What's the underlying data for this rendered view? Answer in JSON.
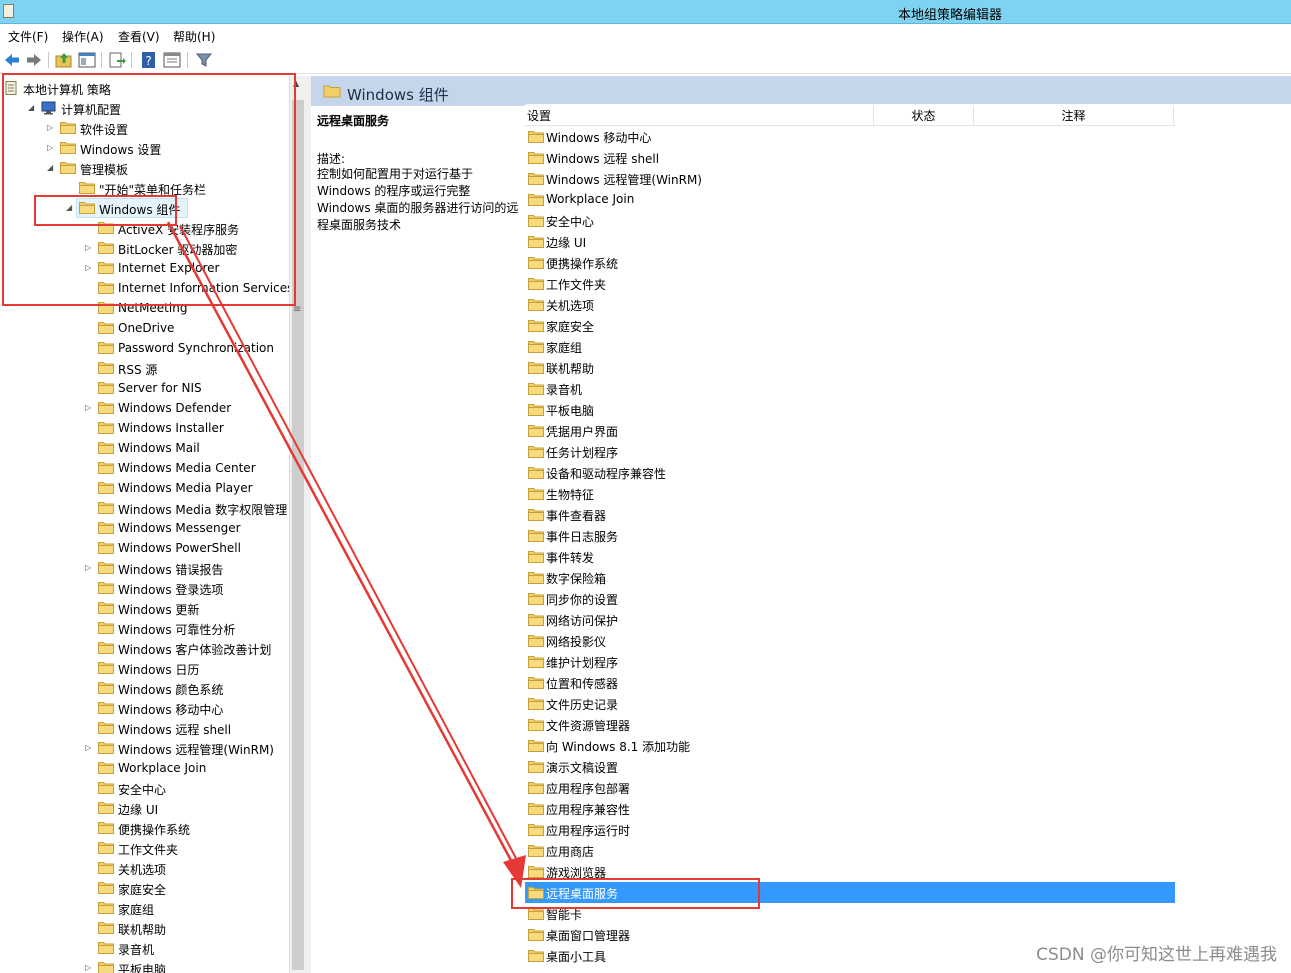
{
  "window": {
    "title": "本地组策略编辑器"
  },
  "menu": [
    "文件(F)",
    "操作(A)",
    "查看(V)",
    "帮助(H)"
  ],
  "toolbar_icons": [
    "back-icon",
    "forward-icon",
    "up-folder-icon",
    "show-hide-tree-icon",
    "export-list-icon",
    "help-icon",
    "properties-icon",
    "filter-icon"
  ],
  "tree": {
    "items": [
      {
        "label": "本地计算机 策略",
        "level": 0,
        "expander": "",
        "icon": "policy"
      },
      {
        "label": "计算机配置",
        "level": 1,
        "expander": "open",
        "icon": "computer"
      },
      {
        "label": "软件设置",
        "level": 2,
        "expander": "closed",
        "icon": "folder"
      },
      {
        "label": "Windows 设置",
        "level": 2,
        "expander": "closed",
        "icon": "folder"
      },
      {
        "label": "管理模板",
        "level": 2,
        "expander": "open",
        "icon": "folder"
      },
      {
        "label": "\"开始\"菜单和任务栏",
        "level": 3,
        "expander": "",
        "icon": "folder"
      },
      {
        "label": "Windows 组件",
        "level": 3,
        "expander": "open",
        "icon": "folder",
        "selected": true
      },
      {
        "label": "ActiveX 安装程序服务",
        "level": 4,
        "expander": "",
        "icon": "folder"
      },
      {
        "label": "BitLocker 驱动器加密",
        "level": 4,
        "expander": "closed",
        "icon": "folder"
      },
      {
        "label": "Internet Explorer",
        "level": 4,
        "expander": "closed",
        "icon": "folder"
      },
      {
        "label": "Internet Information Services",
        "level": 4,
        "expander": "",
        "icon": "folder"
      },
      {
        "label": "NetMeeting",
        "level": 4,
        "expander": "",
        "icon": "folder"
      },
      {
        "label": "OneDrive",
        "level": 4,
        "expander": "",
        "icon": "folder"
      },
      {
        "label": "Password Synchronization",
        "level": 4,
        "expander": "",
        "icon": "folder"
      },
      {
        "label": "RSS 源",
        "level": 4,
        "expander": "",
        "icon": "folder"
      },
      {
        "label": "Server for NIS",
        "level": 4,
        "expander": "",
        "icon": "folder"
      },
      {
        "label": "Windows Defender",
        "level": 4,
        "expander": "closed",
        "icon": "folder"
      },
      {
        "label": "Windows Installer",
        "level": 4,
        "expander": "",
        "icon": "folder"
      },
      {
        "label": "Windows Mail",
        "level": 4,
        "expander": "",
        "icon": "folder"
      },
      {
        "label": "Windows Media Center",
        "level": 4,
        "expander": "",
        "icon": "folder"
      },
      {
        "label": "Windows Media Player",
        "level": 4,
        "expander": "",
        "icon": "folder"
      },
      {
        "label": "Windows Media 数字权限管理",
        "level": 4,
        "expander": "",
        "icon": "folder"
      },
      {
        "label": "Windows Messenger",
        "level": 4,
        "expander": "",
        "icon": "folder"
      },
      {
        "label": "Windows PowerShell",
        "level": 4,
        "expander": "",
        "icon": "folder"
      },
      {
        "label": "Windows 错误报告",
        "level": 4,
        "expander": "closed",
        "icon": "folder"
      },
      {
        "label": "Windows 登录选项",
        "level": 4,
        "expander": "",
        "icon": "folder"
      },
      {
        "label": "Windows 更新",
        "level": 4,
        "expander": "",
        "icon": "folder"
      },
      {
        "label": "Windows 可靠性分析",
        "level": 4,
        "expander": "",
        "icon": "folder"
      },
      {
        "label": "Windows 客户体验改善计划",
        "level": 4,
        "expander": "",
        "icon": "folder"
      },
      {
        "label": "Windows 日历",
        "level": 4,
        "expander": "",
        "icon": "folder"
      },
      {
        "label": "Windows 颜色系统",
        "level": 4,
        "expander": "",
        "icon": "folder"
      },
      {
        "label": "Windows 移动中心",
        "level": 4,
        "expander": "",
        "icon": "folder"
      },
      {
        "label": "Windows 远程 shell",
        "level": 4,
        "expander": "",
        "icon": "folder"
      },
      {
        "label": "Windows 远程管理(WinRM)",
        "level": 4,
        "expander": "closed",
        "icon": "folder"
      },
      {
        "label": "Workplace Join",
        "level": 4,
        "expander": "",
        "icon": "folder"
      },
      {
        "label": "安全中心",
        "level": 4,
        "expander": "",
        "icon": "folder"
      },
      {
        "label": "边缘 UI",
        "level": 4,
        "expander": "",
        "icon": "folder"
      },
      {
        "label": "便携操作系统",
        "level": 4,
        "expander": "",
        "icon": "folder"
      },
      {
        "label": "工作文件夹",
        "level": 4,
        "expander": "",
        "icon": "folder"
      },
      {
        "label": "关机选项",
        "level": 4,
        "expander": "",
        "icon": "folder"
      },
      {
        "label": "家庭安全",
        "level": 4,
        "expander": "",
        "icon": "folder"
      },
      {
        "label": "家庭组",
        "level": 4,
        "expander": "",
        "icon": "folder"
      },
      {
        "label": "联机帮助",
        "level": 4,
        "expander": "",
        "icon": "folder"
      },
      {
        "label": "录音机",
        "level": 4,
        "expander": "",
        "icon": "folder"
      },
      {
        "label": "平板电脑",
        "level": 4,
        "expander": "closed",
        "icon": "folder"
      }
    ]
  },
  "right": {
    "header_title": "Windows 组件",
    "description": {
      "title": "远程桌面服务",
      "label": "描述:",
      "lines": [
        "控制如何配置用于对运行基于",
        "Windows 的程序或运行完整",
        "Windows 桌面的服务器进行访问的远",
        "程桌面服务技术"
      ]
    },
    "columns": [
      "设置",
      "状态",
      "注释"
    ],
    "items": [
      "Windows 移动中心",
      "Windows 远程 shell",
      "Windows 远程管理(WinRM)",
      "Workplace Join",
      "安全中心",
      "边缘 UI",
      "便携操作系统",
      "工作文件夹",
      "关机选项",
      "家庭安全",
      "家庭组",
      "联机帮助",
      "录音机",
      "平板电脑",
      "凭据用户界面",
      "任务计划程序",
      "设备和驱动程序兼容性",
      "生物特征",
      "事件查看器",
      "事件日志服务",
      "事件转发",
      "数字保险箱",
      "同步你的设置",
      "网络访问保护",
      "网络投影仪",
      "维护计划程序",
      "位置和传感器",
      "文件历史记录",
      "文件资源管理器",
      "向 Windows 8.1 添加功能",
      "演示文稿设置",
      "应用程序包部署",
      "应用程序兼容性",
      "应用程序运行时",
      "应用商店",
      "游戏浏览器",
      "远程桌面服务",
      "智能卡",
      "桌面窗口管理器",
      "桌面小工具"
    ],
    "selected_item": "远程桌面服务"
  },
  "annotations": {
    "color": "#e53935"
  },
  "watermark": "CSDN @你可知这世上再难遇我",
  "colors": {
    "titlebar": "#7fd3f0",
    "header": "#c6d6ea",
    "selection": "#3399ff",
    "folder": "#f3cf6a"
  }
}
